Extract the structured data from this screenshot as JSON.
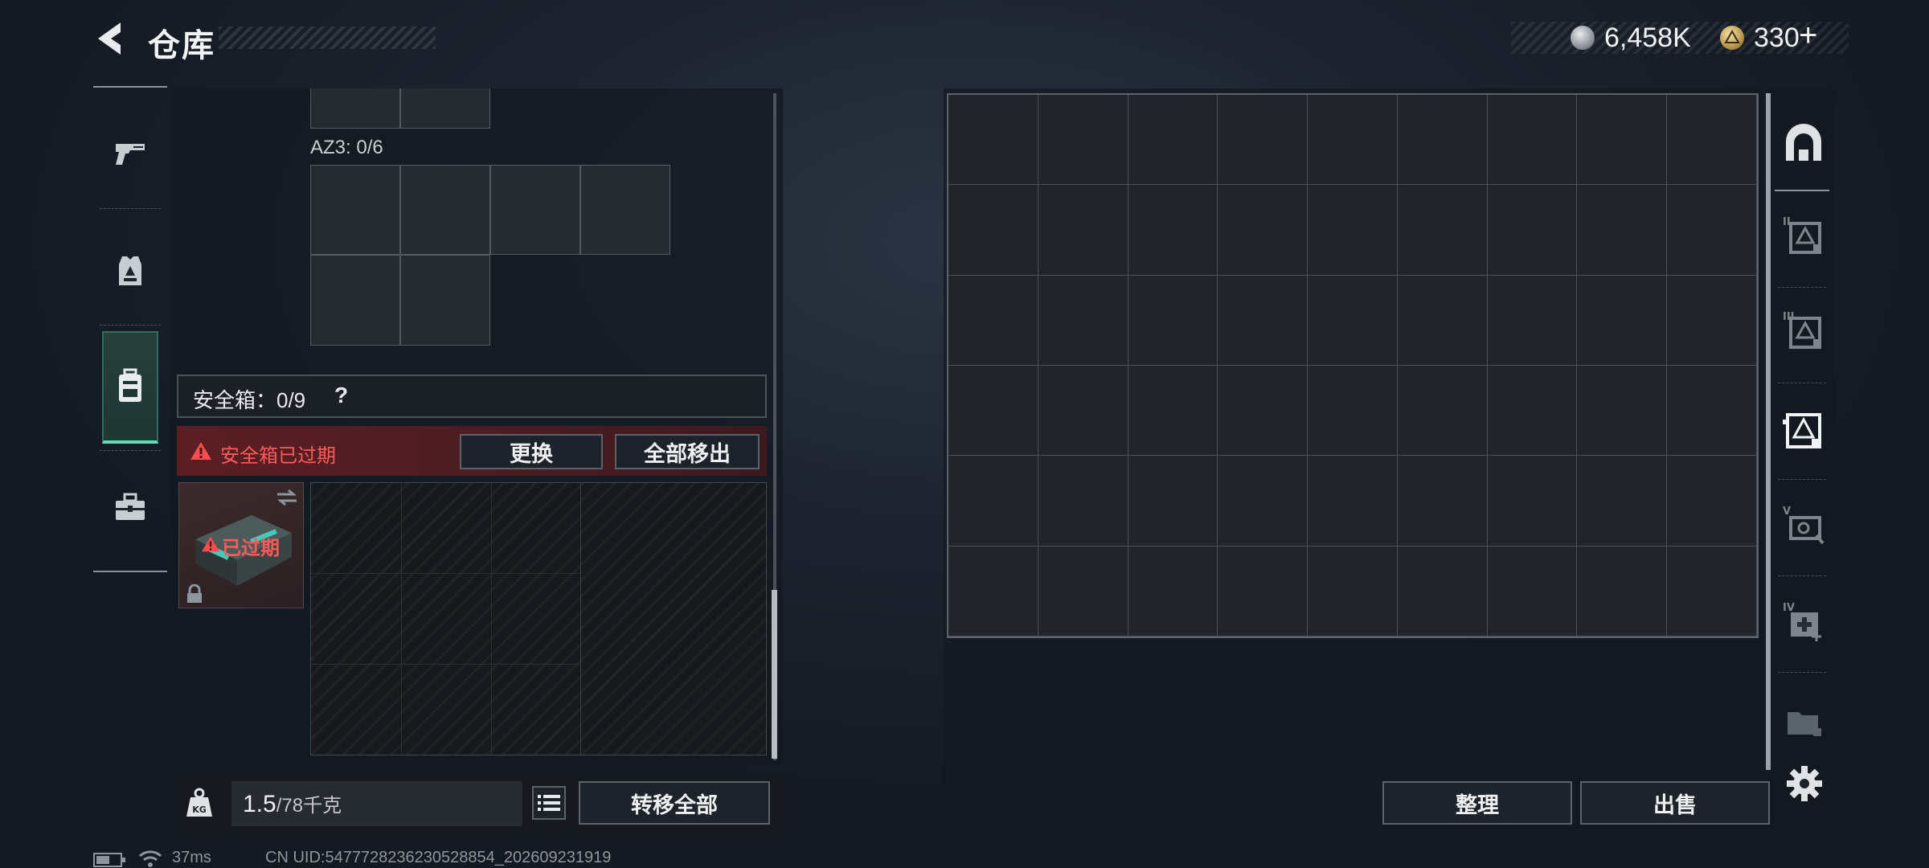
{
  "header": {
    "title": "仓库",
    "currency_coin": "6,458K",
    "currency_bond": "330",
    "plus_label": "+"
  },
  "left_panel": {
    "az3_label": "AZ3: 0/6",
    "safe_box_label": "安全箱：0/9",
    "help_label": "?",
    "expired_banner": "安全箱已过期",
    "replace_label": "更换",
    "remove_all_label": "全部移出",
    "item_status": "已过期",
    "weight_value": "1.5",
    "weight_unit": "/78千克",
    "transfer_all_label": "转移全部"
  },
  "right_panel": {
    "sort_label": "整理",
    "sell_label": "出售",
    "grid_columns": 9,
    "grid_rows": 6
  },
  "right_sidebar": {
    "tier_labels": [
      "II",
      "III",
      "V",
      "IV"
    ]
  },
  "status_bar": {
    "ping": "37ms",
    "uid": "CN UID:5477728236230528854_202609231919"
  },
  "colors": {
    "accent": "#58e0b8",
    "warning": "#ff5a5a",
    "banner_bg": "#5b1f25"
  }
}
